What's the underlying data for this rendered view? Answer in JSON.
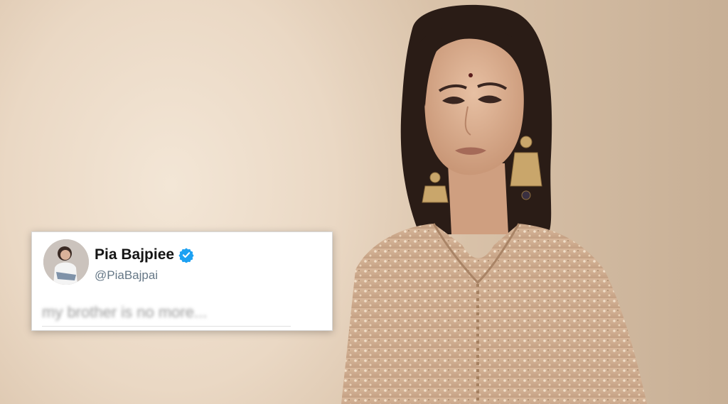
{
  "tweet": {
    "display_name": "Pia Bajpiee",
    "handle": "@PiaBajpai",
    "text": "my brother is no more...",
    "verified": true,
    "verified_color": "#1da1f2",
    "avatar_icon": "profile-photo"
  },
  "colors": {
    "background": "#e9d9c6",
    "card": "#ffffff",
    "handle_text": "#657786"
  }
}
